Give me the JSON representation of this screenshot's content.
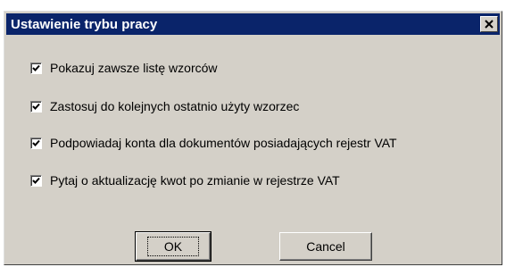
{
  "window": {
    "title": "Ustawienie trybu pracy",
    "close_icon": "close-icon"
  },
  "options": [
    {
      "label": "Pokazuj zawsze listę wzorców",
      "checked": true
    },
    {
      "label": "Zastosuj do kolejnych ostatnio użyty wzorzec",
      "checked": true
    },
    {
      "label": "Podpowiadaj konta dla dokumentów posiadających rejestr VAT",
      "checked": true
    },
    {
      "label": "Pytaj o aktualizację kwot po zmianie w rejestrze VAT",
      "checked": true
    }
  ],
  "buttons": {
    "ok_label": "OK",
    "cancel_label": "Cancel"
  },
  "colors": {
    "titlebar": "#0a246a",
    "dialog_face": "#d4d0c8"
  }
}
